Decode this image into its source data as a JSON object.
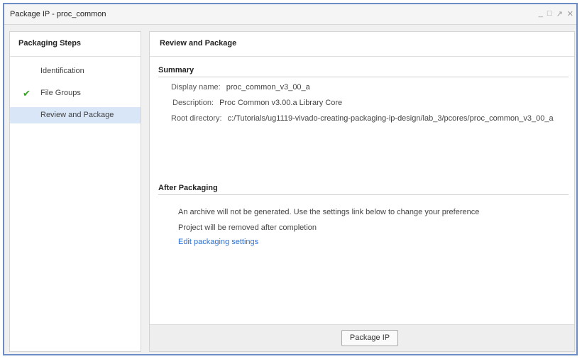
{
  "window": {
    "title": "Package IP - proc_common",
    "controls": {
      "minimize": "_",
      "restore": "□",
      "float": "↗",
      "close": "✕"
    }
  },
  "steps": {
    "header": "Packaging Steps",
    "items": [
      {
        "label": "Identification",
        "done": false,
        "active": false
      },
      {
        "label": "File Groups",
        "done": true,
        "check": "✔",
        "active": false
      },
      {
        "label": "Review and Package",
        "done": false,
        "active": true
      }
    ]
  },
  "content": {
    "header": "Review and Package",
    "summary": {
      "title": "Summary",
      "display_name_label": "Display name:",
      "display_name_value": "proc_common_v3_00_a",
      "description_label": "Description:",
      "description_value": "Proc Common v3.00.a Library Core",
      "root_dir_label": "Root directory:",
      "root_dir_value": "c:/Tutorials/ug1119-vivado-creating-packaging-ip-design/lab_3/pcores/proc_common_v3_00_a"
    },
    "after": {
      "title": "After Packaging",
      "line1": "An archive will not be generated. Use the settings link below to change your preference",
      "line2": "Project will be removed after completion",
      "link": "Edit packaging settings"
    },
    "package_button": "Package IP"
  }
}
